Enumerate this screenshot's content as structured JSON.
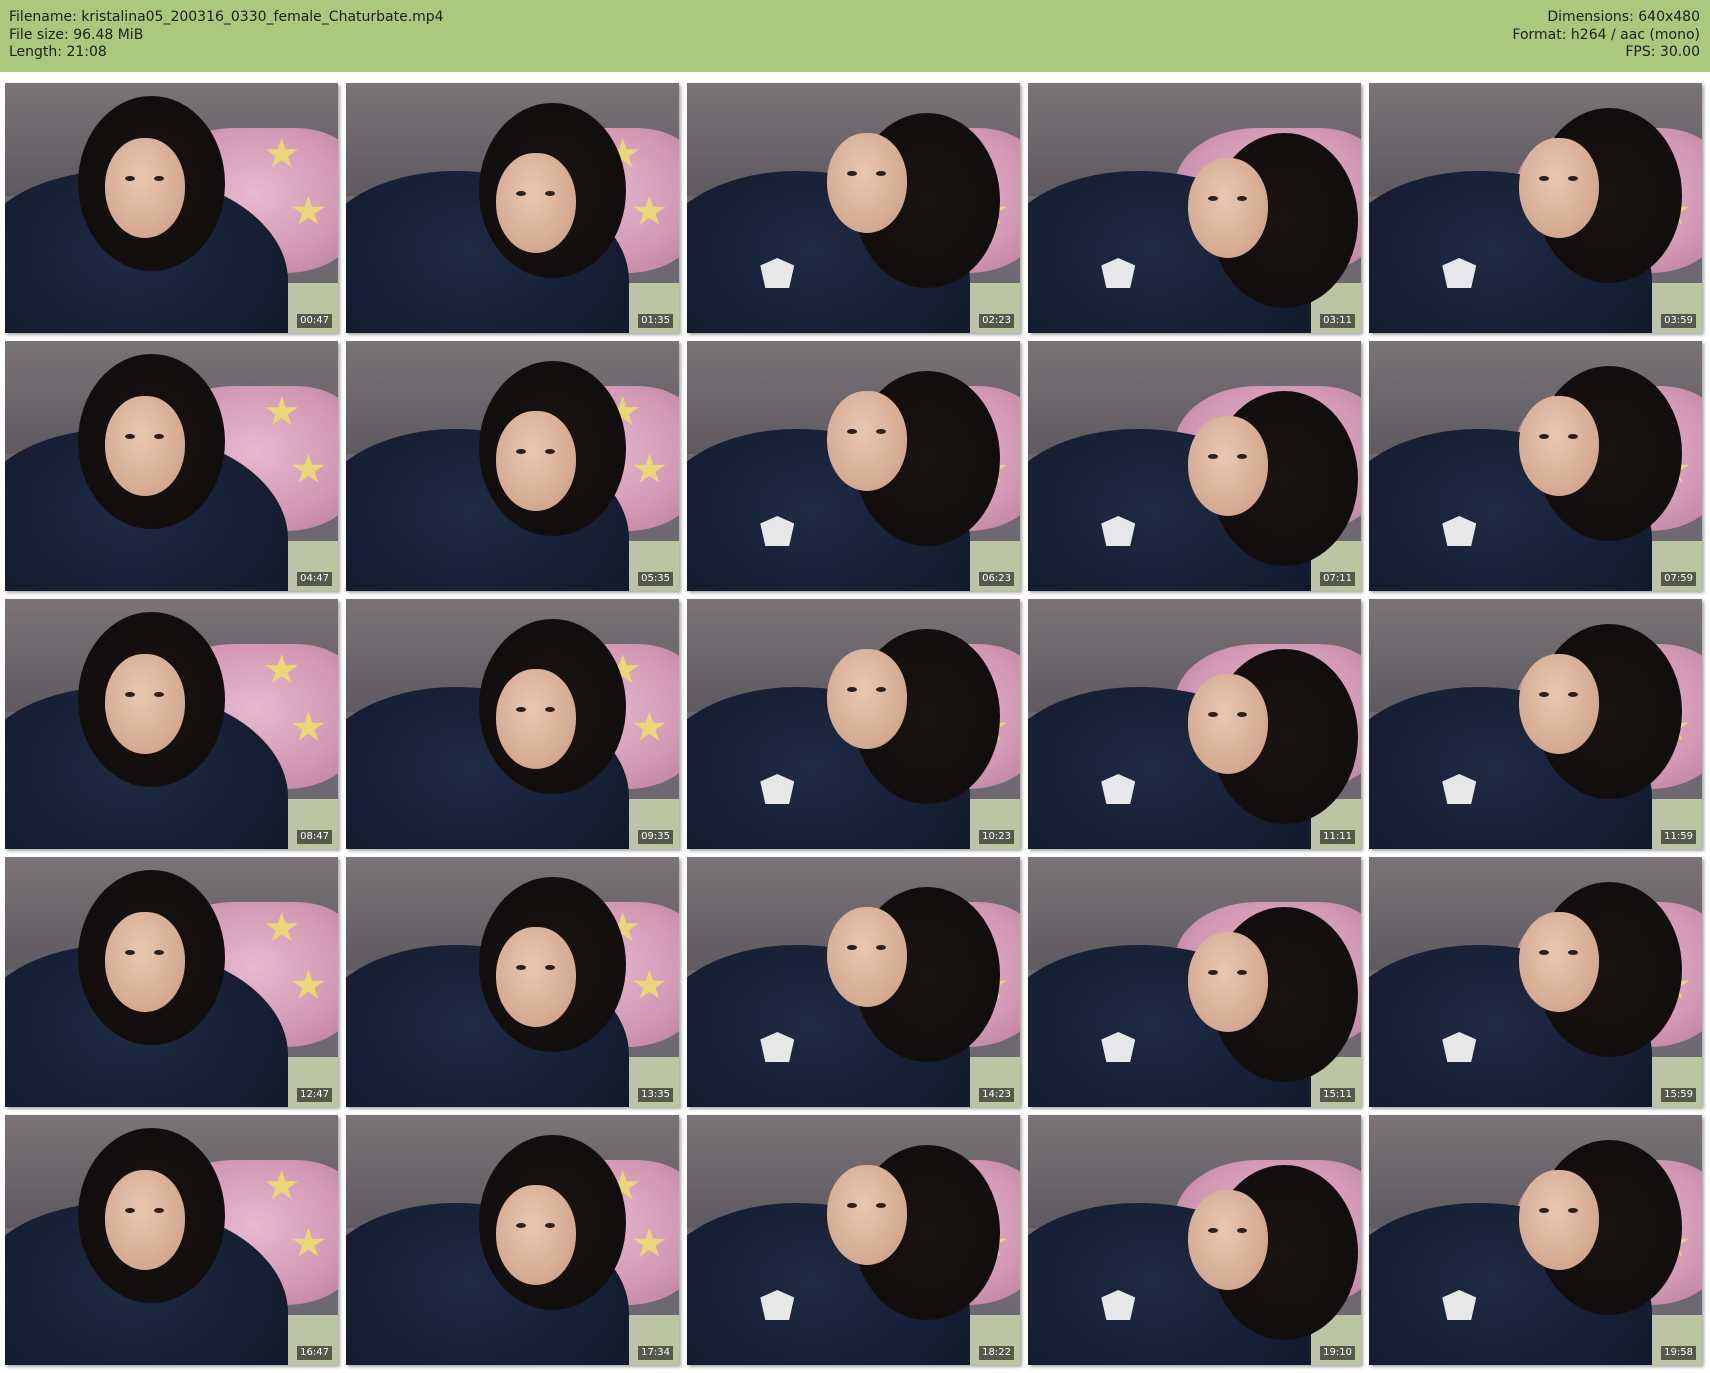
{
  "header": {
    "filename": "Filename: kristalina05_200316_0330_female_Chaturbate.mp4",
    "filesize": "File size: 96.48 MiB",
    "length": "Length: 21:08",
    "dimensions": "Dimensions: 640x480",
    "format": "Format: h264 / aac (mono)",
    "fps": "FPS: 30.00",
    "background_color": "#a8c97e"
  },
  "thumbnails": [
    {
      "timestamp": "00:47"
    },
    {
      "timestamp": "01:35"
    },
    {
      "timestamp": "02:23"
    },
    {
      "timestamp": "03:11"
    },
    {
      "timestamp": "03:59"
    },
    {
      "timestamp": "04:47"
    },
    {
      "timestamp": "05:35"
    },
    {
      "timestamp": "06:23"
    },
    {
      "timestamp": "07:11"
    },
    {
      "timestamp": "07:59"
    },
    {
      "timestamp": "08:47"
    },
    {
      "timestamp": "09:35"
    },
    {
      "timestamp": "10:23"
    },
    {
      "timestamp": "11:11"
    },
    {
      "timestamp": "11:59"
    },
    {
      "timestamp": "12:47"
    },
    {
      "timestamp": "13:35"
    },
    {
      "timestamp": "14:23"
    },
    {
      "timestamp": "15:11"
    },
    {
      "timestamp": "15:59"
    },
    {
      "timestamp": "16:47"
    },
    {
      "timestamp": "17:34"
    },
    {
      "timestamp": "18:22"
    },
    {
      "timestamp": "19:10"
    },
    {
      "timestamp": "19:58"
    }
  ]
}
